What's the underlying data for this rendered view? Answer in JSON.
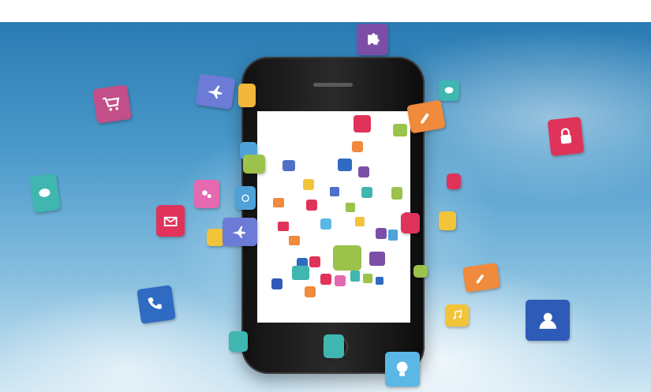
{
  "scene": {
    "description_colors": {
      "sky_top": "#2a7bb3",
      "sky_bottom": "#cfe6f3",
      "phone_body": "#1a1a1a",
      "screen": "#ffffff"
    },
    "icons": [
      {
        "name": "puzzle-icon",
        "color": "#7b4fa8"
      },
      {
        "name": "cart-icon",
        "color": "#c24f8a"
      },
      {
        "name": "plane-icon",
        "color": "#6c7bd6"
      },
      {
        "name": "wifi-icon",
        "color": "#f2b63a"
      },
      {
        "name": "chat-icon",
        "color": "#3fb6b0"
      },
      {
        "name": "pencil-icon",
        "color": "#f08a3c"
      },
      {
        "name": "lock-icon",
        "color": "#e0335a"
      },
      {
        "name": "mail-icon",
        "color": "#e0335a"
      },
      {
        "name": "gears-icon",
        "color": "#e569b0"
      },
      {
        "name": "at-icon",
        "color": "#4fa2d8"
      },
      {
        "name": "music-icon",
        "color": "#f2c43a"
      },
      {
        "name": "phone-call-icon",
        "color": "#2f6bc2"
      },
      {
        "name": "user-icon",
        "color": "#2f5bb8"
      },
      {
        "name": "bulb-icon",
        "color": "#5ab7e6"
      },
      {
        "name": "search-icon",
        "color": "#9bc24a"
      }
    ]
  }
}
